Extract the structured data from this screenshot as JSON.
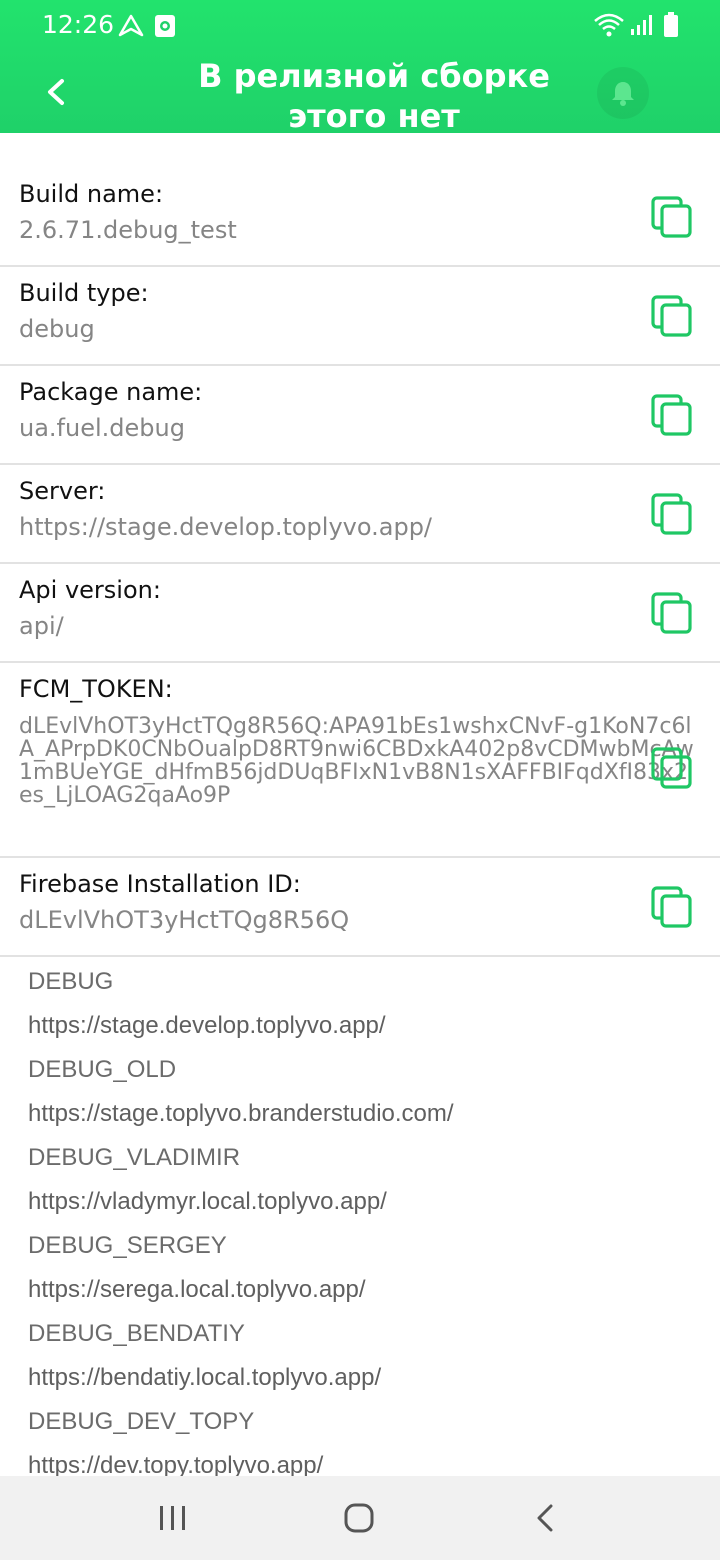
{
  "status_bar": {
    "time": "12:26",
    "icons": [
      "nav-arrow-icon",
      "screen-record-icon",
      "wifi-icon",
      "signal-icon",
      "battery-icon"
    ]
  },
  "header": {
    "title": "В релизной сборке\nэтого нет",
    "back_icon": "chevron-left-icon",
    "bell_icon": "bell-icon"
  },
  "colors": {
    "header_green": "#22e36d",
    "accent_green": "#1fc764",
    "label": "#111111",
    "value_gray": "#858585"
  },
  "rows": [
    {
      "label": "Build name:",
      "value": "2.6.71.debug_test"
    },
    {
      "label": "Build type:",
      "value": "debug"
    },
    {
      "label": "Package name:",
      "value": "ua.fuel.debug"
    },
    {
      "label": "Server:",
      "value": "https://stage.develop.toplyvo.app/"
    },
    {
      "label": "Api version:",
      "value": "api/"
    },
    {
      "label": "FCM_TOKEN:",
      "value": "dLEvlVhOT3yHctTQg8R56Q:APA91bEs1wshxCNvF-g1KoN7c6lA_APrpDK0CNbOualpD8RT9nwi6CBDxkA402p8vCDMwbMcAw1mBUeYGE_dHfmB56jdDUqBFIxN1vB8N1sXAFFBIFqdXfI83x2es_LjLOAG2qaAo9P"
    },
    {
      "label": "Firebase Installation ID:",
      "value": "dLEvlVhOT3yHctTQg8R56Q"
    }
  ],
  "servers": [
    {
      "name": "DEBUG",
      "url": "https://stage.develop.toplyvo.app/"
    },
    {
      "name": "DEBUG_OLD",
      "url": "https://stage.toplyvo.branderstudio.com/"
    },
    {
      "name": "DEBUG_VLADIMIR",
      "url": "https://vladymyr.local.toplyvo.app/"
    },
    {
      "name": "DEBUG_SERGEY",
      "url": "https://serega.local.toplyvo.app/"
    },
    {
      "name": "DEBUG_BENDATIY",
      "url": "https://bendatiy.local.toplyvo.app/"
    },
    {
      "name": "DEBUG_DEV_TOPY",
      "url": "https://dev.topy.toplyvo.app/"
    }
  ],
  "navbar": {
    "icons": [
      "recent-apps-icon",
      "home-icon",
      "back-icon"
    ]
  }
}
